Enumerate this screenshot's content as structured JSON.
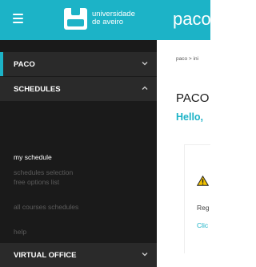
{
  "header": {
    "menu_icon": "hamburger-menu-icon",
    "logo_icon": "university-logo-icon",
    "logo_text": "universidade\nde aveiro",
    "app_name": "paco",
    "background_color": "#1cb3c7"
  },
  "sidebar": {
    "background_color": "#1a1a1a",
    "sections": [
      {
        "label": "PACO",
        "expanded": false,
        "active_indicator": true
      },
      {
        "label": "SCHEDULES",
        "expanded": true,
        "items": [
          {
            "label": "schedules selection",
            "active": false
          },
          {
            "label": "my schedule",
            "active": true
          },
          {
            "label": "free options list",
            "active": false
          },
          {
            "label": "all courses schedules",
            "active": false
          },
          {
            "label": "help",
            "active": false
          }
        ]
      },
      {
        "label": "VIRTUAL OFFICE",
        "expanded": false
      }
    ]
  },
  "main": {
    "breadcrumb": "paco > ini",
    "title": "PACO",
    "greeting": "Hello,",
    "notice": {
      "icon": "warning-icon",
      "text": "Reg",
      "link": "Clic"
    }
  }
}
